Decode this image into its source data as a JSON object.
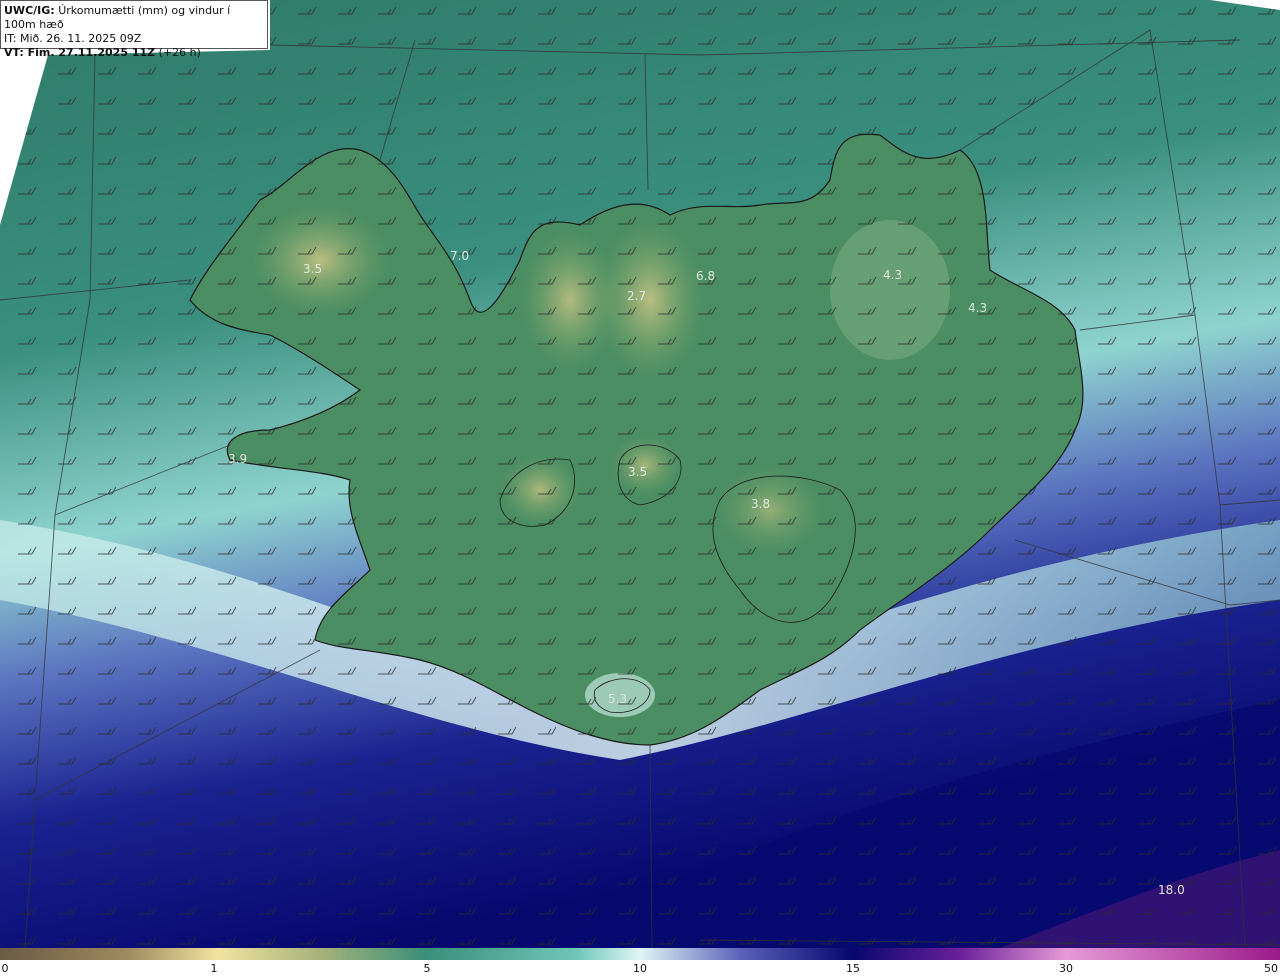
{
  "header": {
    "model_label": "UWC/IG:",
    "title": "Úrkomumætti (mm) og vindur í 100m hæð",
    "init_time": "IT: Mið. 26. 11. 2025 09Z",
    "valid_label": "VT: Fim. 27.11.2025 11Z",
    "valid_offset": "(+26 h)"
  },
  "point_values": [
    {
      "label": "3.5"
    },
    {
      "label": "7.0"
    },
    {
      "label": "6.8"
    },
    {
      "label": "2.7"
    },
    {
      "label": "4.3"
    },
    {
      "label": "4.3"
    },
    {
      "label": "3.9"
    },
    {
      "label": "3.5"
    },
    {
      "label": "3.8"
    },
    {
      "label": "5.3"
    },
    {
      "label": "18.0"
    }
  ],
  "colorbar": {
    "ticks": [
      "0",
      "1",
      "5",
      "10",
      "15",
      "30",
      "50"
    ],
    "colors": [
      "#6b5a45",
      "#a08a5f",
      "#d8c98a",
      "#f2e3a0",
      "#6f9d6b",
      "#3a8f7a",
      "#6fc6b8",
      "#dff5f5",
      "#2a2f9a",
      "#06086e",
      "#6a1f9a",
      "#e69ad6",
      "#9a1a8a"
    ]
  },
  "map_style": {
    "sea_base": "#2f7f72",
    "land_base": "#4a8f5f",
    "highland": "#b7b77a",
    "precip_light": "#bfe9e4",
    "precip_heavy": "#0c1487",
    "coastline": "#1a1a1a",
    "gridline": "#333333",
    "wind_barb": "#2b2b2b"
  }
}
